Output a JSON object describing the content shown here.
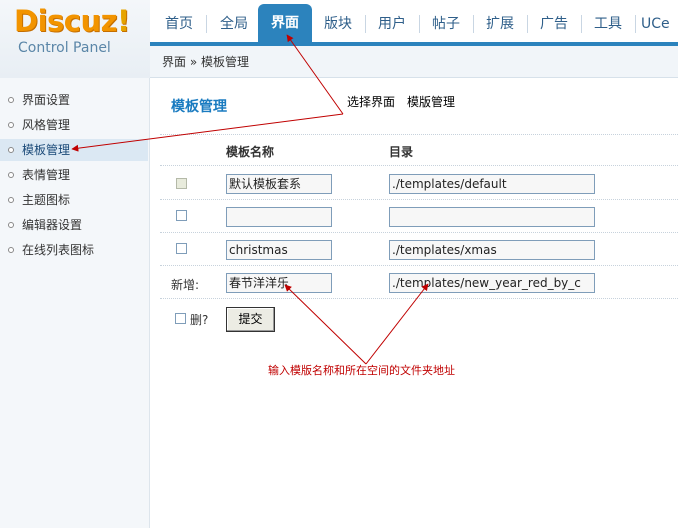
{
  "logo": {
    "main": "Discuz",
    "bang": "!",
    "sub": "Control Panel"
  },
  "topnav": [
    {
      "label": "首页"
    },
    {
      "label": "全局"
    },
    {
      "label": "界面",
      "active": true
    },
    {
      "label": "版块"
    },
    {
      "label": "用户"
    },
    {
      "label": "帖子"
    },
    {
      "label": "扩展"
    },
    {
      "label": "广告"
    },
    {
      "label": "工具"
    },
    {
      "label": "UCe"
    }
  ],
  "breadcrumb": "界面 » 模板管理",
  "sidebar": [
    {
      "label": "界面设置"
    },
    {
      "label": "风格管理"
    },
    {
      "label": "模板管理",
      "active": true
    },
    {
      "label": "表情管理"
    },
    {
      "label": "主题图标"
    },
    {
      "label": "编辑器设置"
    },
    {
      "label": "在线列表图标"
    }
  ],
  "main": {
    "title": "模板管理",
    "tabs": [
      "选择界面",
      "模版管理"
    ],
    "col_name": "模板名称",
    "col_dir": "目录",
    "rows": [
      {
        "name": "默认模板套系",
        "dir": "./templates/default",
        "check_disabled": true
      },
      {
        "name": "",
        "dir": ""
      },
      {
        "name": "christmas",
        "dir": "./templates/xmas"
      }
    ],
    "new_label": "新增:",
    "new_name": "春节洋洋乐",
    "new_dir": "./templates/new_year_red_by_c",
    "delete_label": "删?",
    "submit_label": "提交"
  },
  "annotation": "输入模版名称和所在空间的文件夹地址",
  "colors": {
    "accent": "#2c83bd",
    "annotation": "#c00000",
    "logo": "#f29400"
  }
}
